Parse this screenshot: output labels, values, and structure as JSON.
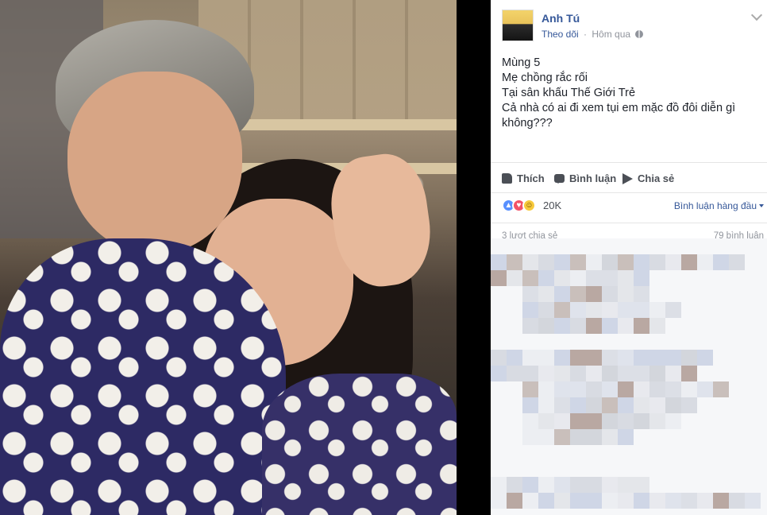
{
  "author": {
    "name": "Anh Tú"
  },
  "post_meta": {
    "follow_label": "Theo dõi",
    "separator": "·",
    "time": "Hôm qua"
  },
  "post_text": [
    "Mùng 5",
    "Mẹ chồng rắc rối",
    "Tại sân khấu Thế Giới Trẻ",
    "Cả nhà có ai đi xem tụi em mặc đồ đôi diễn gì",
    "không???"
  ],
  "actions": {
    "like": "Thích",
    "comment": "Bình luận",
    "share": "Chia sẻ"
  },
  "reactions": {
    "count": "20K",
    "sort_label": "Bình luận hàng đầu"
  },
  "stats": {
    "shares": "3 lượt chia sẻ",
    "comments": "79 bình luận"
  },
  "colors": {
    "link": "#365899",
    "text": "#1d2129",
    "muted": "#90949c",
    "like_reaction": "#5890ff",
    "love_reaction": "#f25268"
  },
  "icons": [
    "globe-icon",
    "chevron-down-icon",
    "like-icon",
    "comment-icon",
    "share-icon"
  ]
}
